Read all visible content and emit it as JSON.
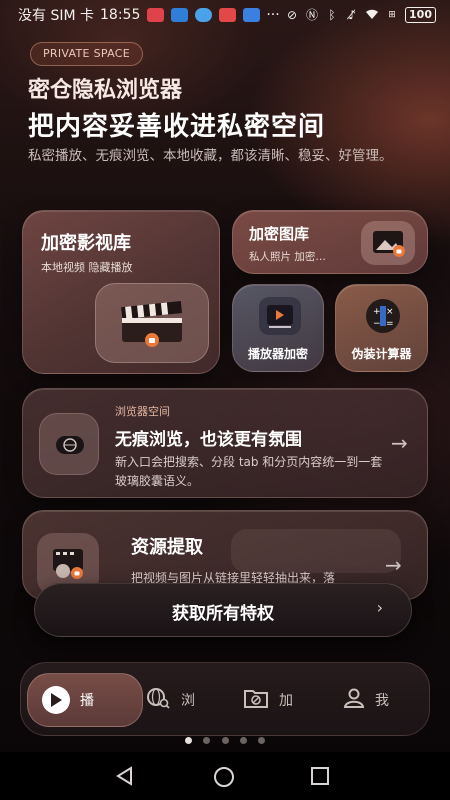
{
  "status_bar": {
    "carrier": "没有 SIM 卡",
    "time": "18:55",
    "more": "···",
    "battery": "100",
    "icons": [
      "app-red-icon",
      "app-blue-icon",
      "cloud-icon",
      "app-red2-icon",
      "bulb-icon",
      "dnd-icon",
      "nfc-icon",
      "bluetooth-icon",
      "mute-icon",
      "wifi-icon",
      "volte-icon",
      "battery-icon"
    ]
  },
  "header": {
    "badge": "PRIVATE SPACE",
    "title": "密仓隐私浏览器",
    "headline": "把内容妥善收进私密空间",
    "description": "私密播放、无痕浏览、本地收藏，都该清晰、稳妥、好管理。"
  },
  "cards": {
    "video_vault": {
      "title": "加密影视库",
      "subtitle": "本地视频 隐藏播放"
    },
    "gallery": {
      "title": "加密图库",
      "subtitle": "私人照片 加密…"
    },
    "player_lock": {
      "label": "播放器加密"
    },
    "fake_calc": {
      "label": "伪装计算器"
    },
    "browse": {
      "kicker": "浏览器空间",
      "title": "无痕浏览，也该更有氛围",
      "description": "新入口会把搜索、分段 tab 和分页内容统一到一套玻璃胶囊语义。",
      "arrow": "→"
    },
    "resource": {
      "title": "资源提取",
      "description": "把视频与图片从链接里轻轻抽出来，落",
      "arrow": "→"
    }
  },
  "cta": {
    "label": "获取所有特权",
    "chevron": "›"
  },
  "tabbar": {
    "tabs": [
      {
        "label": "播",
        "icon": "play-icon",
        "active": true
      },
      {
        "label": "浏",
        "icon": "browser-search-icon",
        "active": false
      },
      {
        "label": "加",
        "icon": "folder-lock-icon",
        "active": false
      },
      {
        "label": "我",
        "icon": "person-icon",
        "active": false
      }
    ]
  },
  "page_indicator": {
    "total": 5,
    "current": 1
  },
  "colors": {
    "accent": "#e3b6a2",
    "background": "#0d0809",
    "lock_orange": "#e8793a"
  }
}
